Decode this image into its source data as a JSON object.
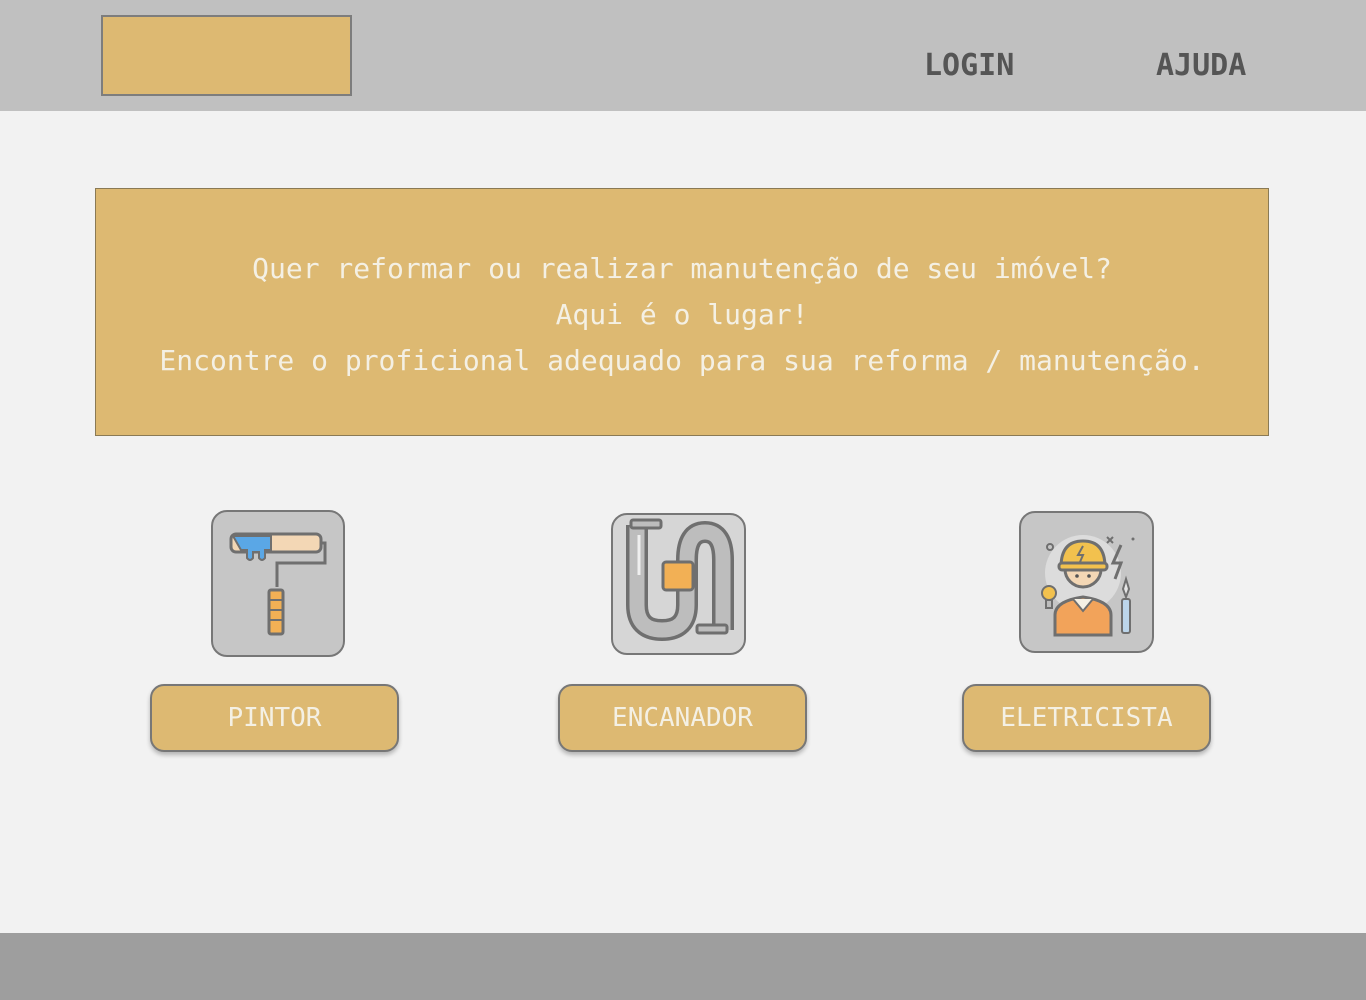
{
  "header": {
    "nav": {
      "login": "LOGIN",
      "help": "AJUDA"
    }
  },
  "banner": {
    "line1": "Quer reformar ou realizar manutenção de seu imóvel?",
    "line2": "Aqui é o lugar!",
    "line3": "Encontre o proficional adequado para sua reforma / manutenção."
  },
  "services": [
    {
      "label": "PINTOR",
      "icon": "paint-roller-icon"
    },
    {
      "label": "ENCANADOR",
      "icon": "pipe-icon"
    },
    {
      "label": "ELETRICISTA",
      "icon": "electrician-icon"
    }
  ],
  "colors": {
    "accent": "#ddb972",
    "header_bg": "#c0c0c0",
    "footer_bg": "#9e9e9e",
    "page_bg": "#f2f2f2"
  }
}
